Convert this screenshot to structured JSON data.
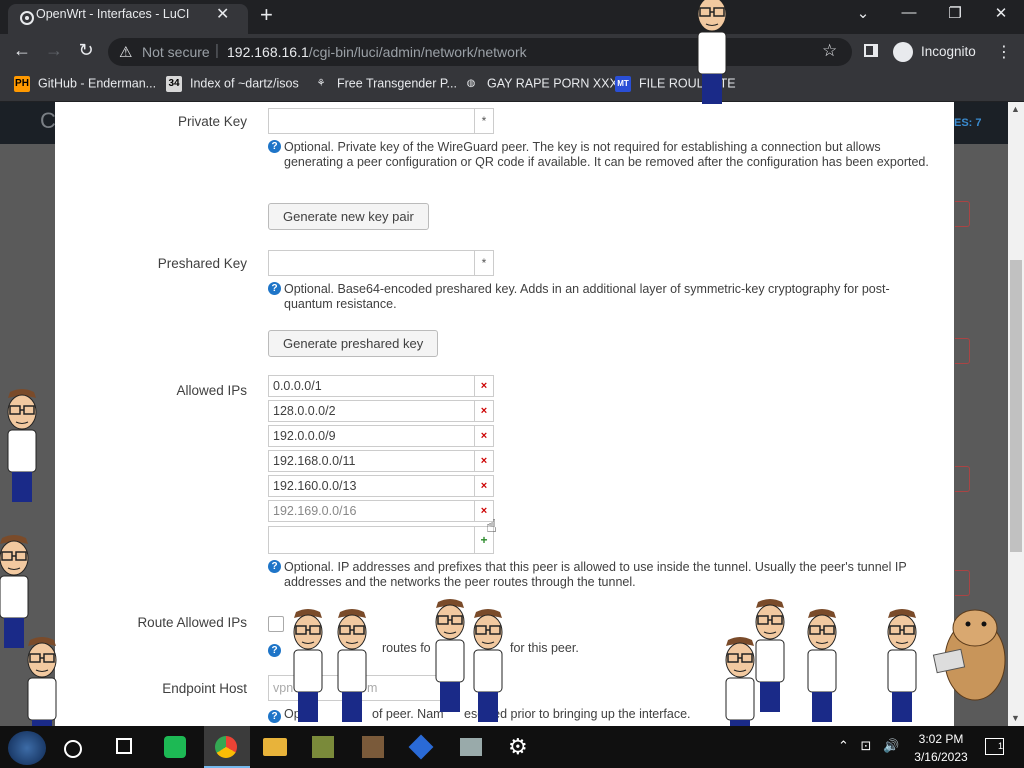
{
  "browser": {
    "tab_title": "OpenWrt - Interfaces - LuCI",
    "tab_close": "✕",
    "new_tab": "+",
    "not_secure": "Not secure",
    "url_host": "192.168.16.1",
    "url_path": "/cgi-bin/luci/admin/network/network",
    "profile_label": "Incognito",
    "window_buttons": [
      "⌄",
      "—",
      "❐",
      "✕"
    ]
  },
  "bookmarks": [
    {
      "label": "GitHub - Enderman...",
      "icon_text": "PH",
      "icon_bg": "#ff9900",
      "icon_fg": "#000"
    },
    {
      "label": "Index of ~dartz/isos",
      "icon_text": "34",
      "icon_bg": "#d8d8d8",
      "icon_fg": "#000"
    },
    {
      "label": "Free Transgender P...",
      "icon_text": "⚘",
      "icon_bg": "transparent",
      "icon_fg": "#e8eaed"
    },
    {
      "label": "GAY RAPE PORN XXX",
      "icon_text": "◍",
      "icon_bg": "transparent",
      "icon_fg": "#e8eaed"
    },
    {
      "label": "FILE ROULETTE",
      "icon_text": "MT",
      "icon_bg": "#2a4fd6",
      "icon_fg": "#fff"
    }
  ],
  "banner": {
    "badge": "ES: 7",
    "letter": "C"
  },
  "form": {
    "private_key": {
      "label": "Private Key",
      "value": "",
      "side": "*",
      "help": "Optional. Private key of the WireGuard peer. The key is not required for establishing a connection but allows generating a peer configuration or QR code if available. It can be removed after the configuration has been exported.",
      "button": "Generate new key pair"
    },
    "preshared_key": {
      "label": "Preshared Key",
      "value": "",
      "side": "*",
      "help": "Optional. Base64-encoded preshared key. Adds in an additional layer of symmetric-key cryptography for post-quantum resistance.",
      "button": "Generate preshared key"
    },
    "allowed_ips": {
      "label": "Allowed IPs",
      "entries": [
        "0.0.0.0/1",
        "128.0.0.0/2",
        "192.0.0.0/9",
        "192.168.0.0/11",
        "192.160.0.0/13",
        "192.169.0.0/16"
      ],
      "remove_symbol": "×",
      "new_value": "",
      "add_symbol": "+",
      "help": "Optional. IP addresses and prefixes that this peer is allowed to use inside the tunnel. Usually the peer's tunnel IP addresses and the networks the peer routes through the tunnel."
    },
    "route_allowed_ips": {
      "label": "Route Allowed IPs",
      "checked": false,
      "help_fragment_1": "routes fo",
      "help_fragment_2": "for this peer."
    },
    "endpoint_host": {
      "label": "Endpoint Host",
      "placeholder_fragment_1": "vpn",
      "placeholder_fragment_2": "m",
      "help_fragment_1": "Op",
      "help_fragment_2": "of peer. Nam",
      "help_fragment_3": "esolved prior to bringing up the interface."
    },
    "help_icon": "?"
  },
  "taskbar": {
    "time": "3:02 PM",
    "date": "3/16/2023",
    "notifications": "1",
    "tray": "⌃ ⊡ 🔊"
  },
  "colors": {
    "accent": "#1e75c8",
    "remove": "#cc0000",
    "add": "#2a8a2a",
    "page_dim": "#5a5a5a"
  }
}
